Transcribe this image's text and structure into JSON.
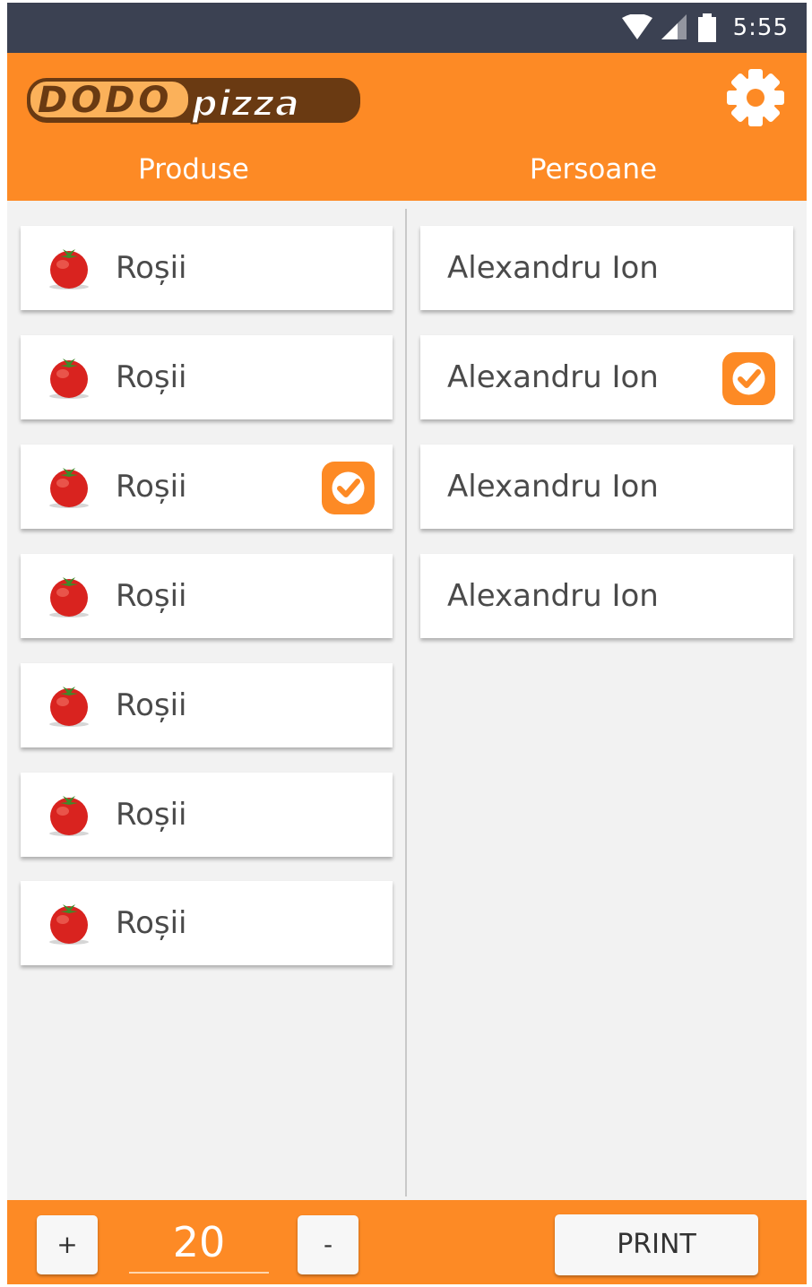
{
  "status_bar": {
    "time": "5:55"
  },
  "header": {
    "logo_text": "DODOPIZZA",
    "tabs": [
      {
        "label": "Produse"
      },
      {
        "label": "Persoane"
      }
    ]
  },
  "products": [
    {
      "label": "Roșii",
      "icon": "tomato-icon",
      "checked": false
    },
    {
      "label": "Roșii",
      "icon": "tomato-icon",
      "checked": false
    },
    {
      "label": "Roșii",
      "icon": "tomato-icon",
      "checked": true
    },
    {
      "label": "Roșii",
      "icon": "tomato-icon",
      "checked": false
    },
    {
      "label": "Roșii",
      "icon": "tomato-icon",
      "checked": false
    },
    {
      "label": "Roșii",
      "icon": "tomato-icon",
      "checked": false
    },
    {
      "label": "Roșii",
      "icon": "tomato-icon",
      "checked": false
    }
  ],
  "people": [
    {
      "label": "Alexandru Ion",
      "checked": false
    },
    {
      "label": "Alexandru Ion",
      "checked": true
    },
    {
      "label": "Alexandru Ion",
      "checked": false
    },
    {
      "label": "Alexandru Ion",
      "checked": false
    }
  ],
  "footer": {
    "plus_label": "+",
    "quantity": "20",
    "minus_label": "-",
    "print_label": "PRINT"
  },
  "colors": {
    "accent": "#fd8a25",
    "status_bar": "#3b4152",
    "background": "#f2f2f2"
  }
}
